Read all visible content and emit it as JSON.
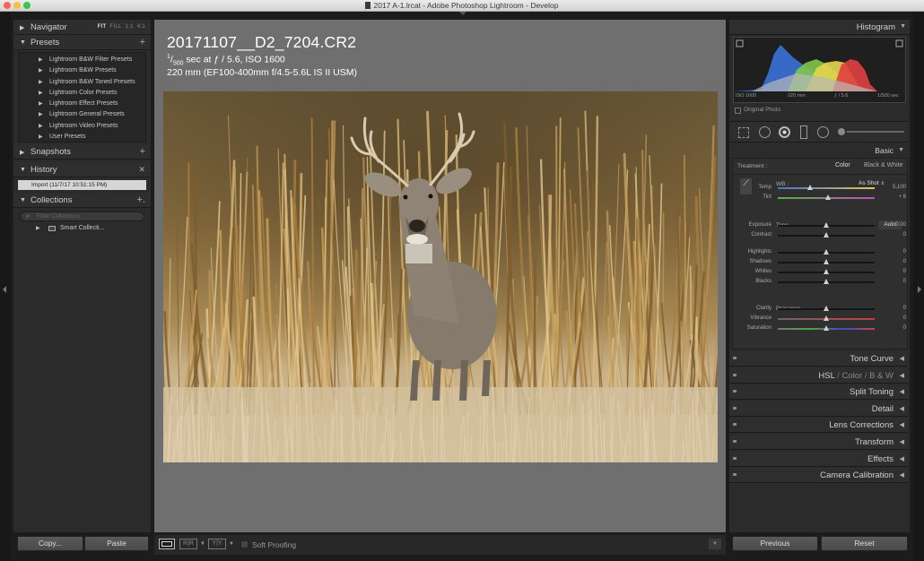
{
  "window": {
    "title": "2017 A-1.lrcat - Adobe Photoshop Lightroom - Develop"
  },
  "colors": {
    "tl_close": "#fc605c",
    "tl_min": "#fdbc40",
    "tl_max": "#34c84a"
  },
  "left": {
    "navigator": {
      "label": "Navigator",
      "modes": [
        "FIT",
        "FILL",
        "1:1",
        "4:1"
      ]
    },
    "presets": {
      "label": "Presets",
      "items": [
        "Lightroom B&W Filter Presets",
        "Lightroom B&W Presets",
        "Lightroom B&W Toned Presets",
        "Lightroom Color Presets",
        "Lightroom Effect Presets",
        "Lightroom General Presets",
        "Lightroom Video Presets",
        "User Presets"
      ]
    },
    "snapshots": {
      "label": "Snapshots"
    },
    "history": {
      "label": "History",
      "items": [
        "Import (11/7/17 10:51:15 PM)"
      ]
    },
    "collections": {
      "label": "Collections",
      "filter_placeholder": "Filter Collections",
      "items": [
        "Smart Collecti..."
      ]
    },
    "buttons": {
      "copy": "Copy...",
      "paste": "Paste"
    }
  },
  "center": {
    "filename": "20171107__D2_7204.CR2",
    "shutter_num": "1",
    "shutter_den": "500",
    "exposure_rest": " sec at ƒ / 5.6, ISO 1600",
    "lens": "220 mm (EF100-400mm f/4.5-5.6L IS II USM)"
  },
  "toolbar": {
    "soft_proofing": "Soft Proofing"
  },
  "right": {
    "histogram": {
      "label": "Histogram",
      "info": [
        "ISO 1600",
        "220 mm",
        "ƒ / 5.6",
        "1/500 sec"
      ],
      "original_photo": "Original Photo"
    },
    "basic": {
      "label": "Basic",
      "treatment_label": "Treatment :",
      "treatment_color": "Color",
      "treatment_bw": "Black & White",
      "wb_label": "WB :",
      "wb_value": "As Shot",
      "tone_label": "Tone",
      "auto_label": "Auto",
      "presence_label": "Presence",
      "sliders": [
        {
          "label": "Temp",
          "value": "5,100",
          "pos": 0.33,
          "group": "wb"
        },
        {
          "label": "Tint",
          "value": "+ 6",
          "pos": 0.52,
          "group": "wb"
        },
        {
          "label": "Exposure",
          "value": "0.00",
          "pos": 0.5,
          "group": "tone"
        },
        {
          "label": "Contrast",
          "value": "0",
          "pos": 0.5,
          "group": "tone"
        },
        {
          "label": "Highlights",
          "value": "0",
          "pos": 0.5,
          "group": "tone2"
        },
        {
          "label": "Shadows",
          "value": "0",
          "pos": 0.5,
          "group": "tone2"
        },
        {
          "label": "Whites",
          "value": "0",
          "pos": 0.5,
          "group": "tone2"
        },
        {
          "label": "Blacks",
          "value": "0",
          "pos": 0.5,
          "group": "tone2"
        },
        {
          "label": "Clarity",
          "value": "0",
          "pos": 0.5,
          "group": "presence"
        },
        {
          "label": "Vibrance",
          "value": "0",
          "pos": 0.5,
          "group": "presence"
        },
        {
          "label": "Saturation",
          "value": "0",
          "pos": 0.5,
          "group": "presence"
        }
      ]
    },
    "panels": [
      {
        "label": "Tone Curve"
      },
      {
        "label": "HSL",
        "extra": [
          "Color",
          "B & W"
        ]
      },
      {
        "label": "Split Toning"
      },
      {
        "label": "Detail"
      },
      {
        "label": "Lens Corrections"
      },
      {
        "label": "Transform"
      },
      {
        "label": "Effects"
      },
      {
        "label": "Camera Calibration"
      }
    ],
    "buttons": {
      "previous": "Previous",
      "reset": "Reset"
    }
  }
}
